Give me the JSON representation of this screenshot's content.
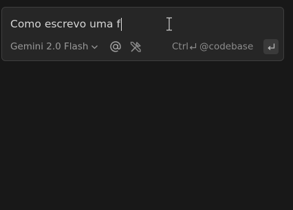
{
  "chat": {
    "input_value": "Como escrevo uma f"
  },
  "toolbar": {
    "model_label": "Gemini 2.0 Flash",
    "shortcut_modifier": "Ctrl",
    "shortcut_target": "@codebase"
  },
  "icons": {
    "model_chevron": "chevron-down-icon",
    "mention": "at-sign-icon",
    "tools": "tools-icon",
    "shortcut_enter": "enter-key-icon",
    "submit": "enter-key-icon",
    "cursor": "text-cursor-icon"
  },
  "colors": {
    "background": "#181818",
    "panel": "#262626",
    "panel_border": "#3f3f3f",
    "text": "#d6d6d6",
    "muted_text": "#9a9a9a",
    "submit_bg": "#3a3a3a"
  }
}
